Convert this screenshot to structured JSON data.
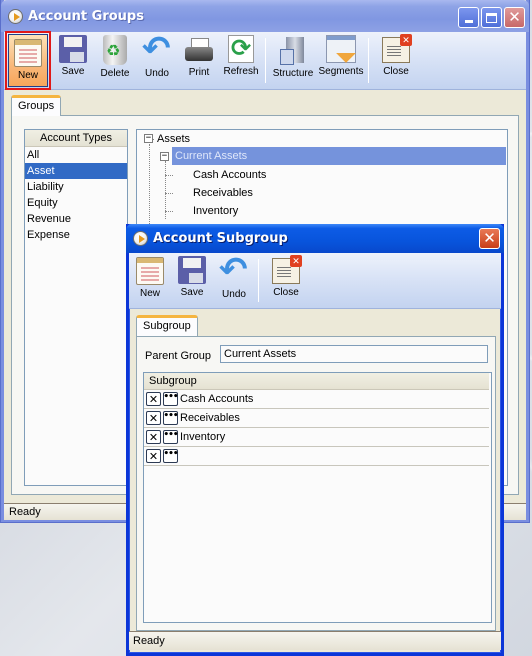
{
  "main_window": {
    "title": "Account Groups",
    "toolbar": [
      {
        "id": "new",
        "label": "New",
        "icon": "new-document-icon",
        "active": true
      },
      {
        "id": "save",
        "label": "Save",
        "icon": "floppy-disk-icon"
      },
      {
        "id": "delete",
        "label": "Delete",
        "icon": "recycle-bin-icon"
      },
      {
        "id": "undo",
        "label": "Undo",
        "icon": "undo-arrow-icon"
      },
      {
        "id": "print",
        "label": "Print",
        "icon": "printer-icon"
      },
      {
        "id": "refresh",
        "label": "Refresh",
        "icon": "refresh-icon"
      },
      {
        "id": "structure",
        "label": "Structure",
        "icon": "building-icon"
      },
      {
        "id": "segments",
        "label": "Segments",
        "icon": "segments-icon"
      },
      {
        "id": "close",
        "label": "Close",
        "icon": "close-window-icon"
      }
    ],
    "tab": "Groups",
    "account_types": {
      "header": "Account Types",
      "items": [
        "All",
        "Asset",
        "Liability",
        "Equity",
        "Revenue",
        "Expense"
      ],
      "selected": "Asset"
    },
    "tree": {
      "root": {
        "label": "Assets",
        "expander": "−"
      },
      "child": {
        "label": "Current Assets",
        "expander": "−",
        "selected": true
      },
      "leaves": [
        "Cash Accounts",
        "Receivables",
        "Inventory"
      ]
    },
    "status": "Ready"
  },
  "dialog": {
    "title": "Account Subgroup",
    "toolbar": [
      {
        "id": "new",
        "label": "New",
        "icon": "new-document-icon"
      },
      {
        "id": "save",
        "label": "Save",
        "icon": "floppy-disk-icon"
      },
      {
        "id": "undo",
        "label": "Undo",
        "icon": "undo-arrow-icon"
      },
      {
        "id": "close",
        "label": "Close",
        "icon": "close-window-icon"
      }
    ],
    "tab": "Subgroup",
    "parent_group_label": "Parent Group",
    "parent_group_value": "Current Assets",
    "grid": {
      "header": "Subgroup",
      "rows": [
        "Cash Accounts",
        "Receivables",
        "Inventory",
        ""
      ],
      "delete_glyph": "✕",
      "edit_glyph": "•••"
    },
    "status": "Ready"
  }
}
